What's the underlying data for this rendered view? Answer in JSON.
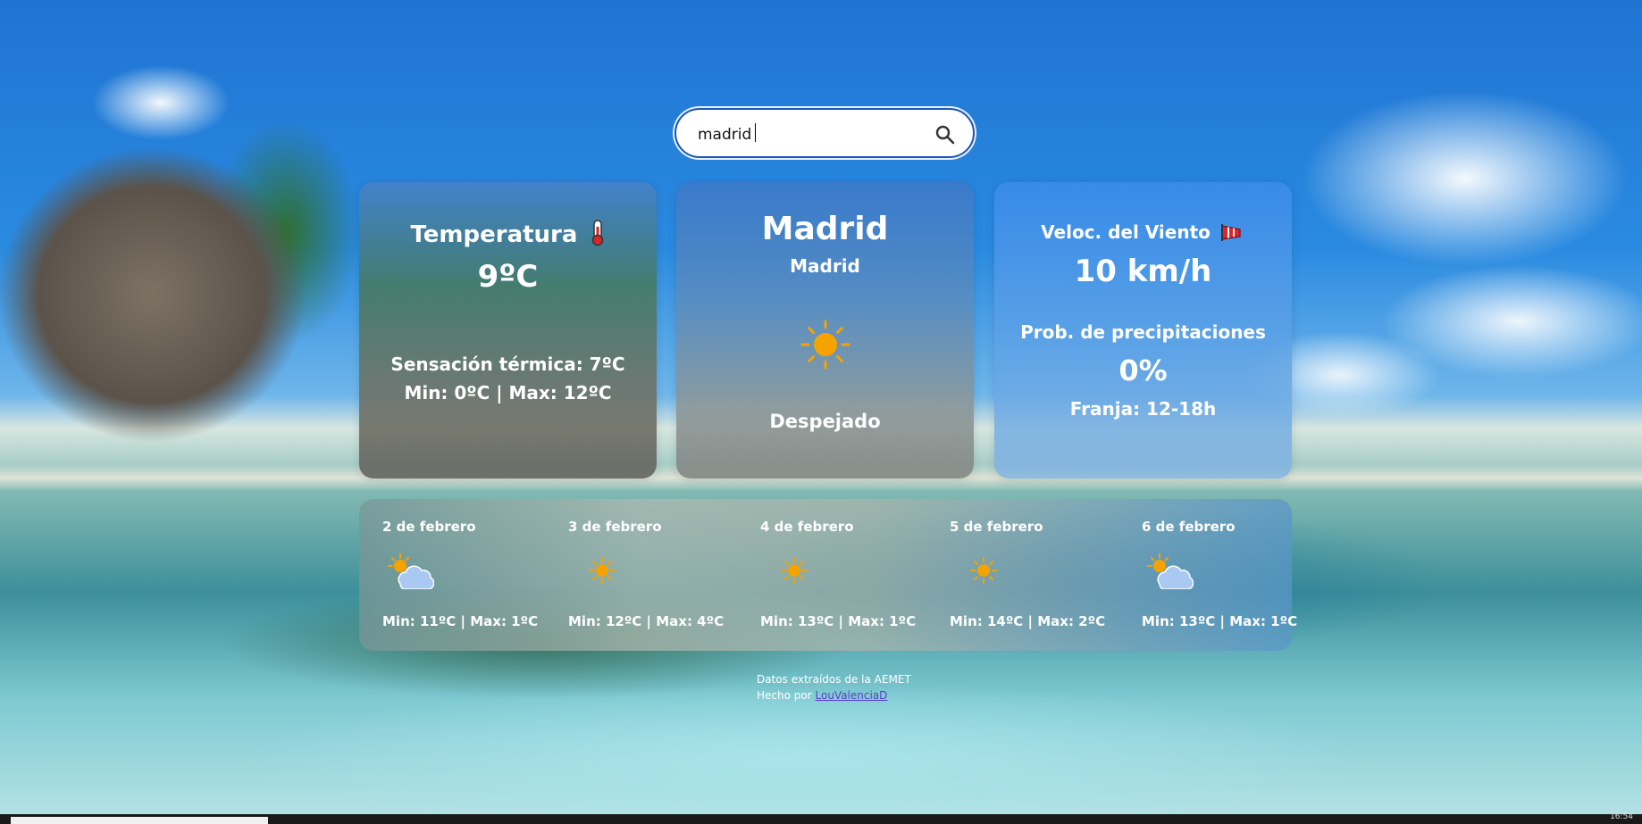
{
  "search": {
    "value": "madrid",
    "icon": "search-icon"
  },
  "temperature": {
    "title": "Temperatura",
    "icon": "thermometer-icon",
    "value": "9ºC",
    "feels_like": "Sensación térmica: 7ºC",
    "minmax": "Min: 0ºC | Max: 12ºC"
  },
  "location": {
    "city": "Madrid",
    "province": "Madrid",
    "icon": "sun-icon",
    "condition": "Despejado"
  },
  "wind": {
    "title": "Veloc. del Viento",
    "icon": "windsock-icon",
    "value": "10 km/h",
    "precip_title": "Prob. de precipitaciones",
    "precip_value": "0%",
    "precip_range": "Franja: 12-18h"
  },
  "forecast": [
    {
      "date": "2 de febrero",
      "icon": "sun-cloud-icon",
      "minmax": "Min: 11ºC | Max: 1ºC"
    },
    {
      "date": "3 de febrero",
      "icon": "sun-icon",
      "minmax": "Min: 12ºC | Max: 4ºC"
    },
    {
      "date": "4 de febrero",
      "icon": "sun-icon",
      "minmax": "Min: 13ºC | Max: 1ºC"
    },
    {
      "date": "5 de febrero",
      "icon": "sun-icon",
      "minmax": "Min: 14ºC | Max: 2ºC"
    },
    {
      "date": "6 de febrero",
      "icon": "sun-cloud-icon",
      "minmax": "Min: 13ºC | Max: 1ºC"
    }
  ],
  "footer": {
    "source": "Datos extraídos de la AEMET",
    "made_by": "Hecho por",
    "author": "LouValenciaD"
  },
  "taskbar": {
    "time": "16:54"
  },
  "colors": {
    "sun": "#f5a300",
    "cloud": "#a9c8f2",
    "accent": "#1c54b8"
  }
}
